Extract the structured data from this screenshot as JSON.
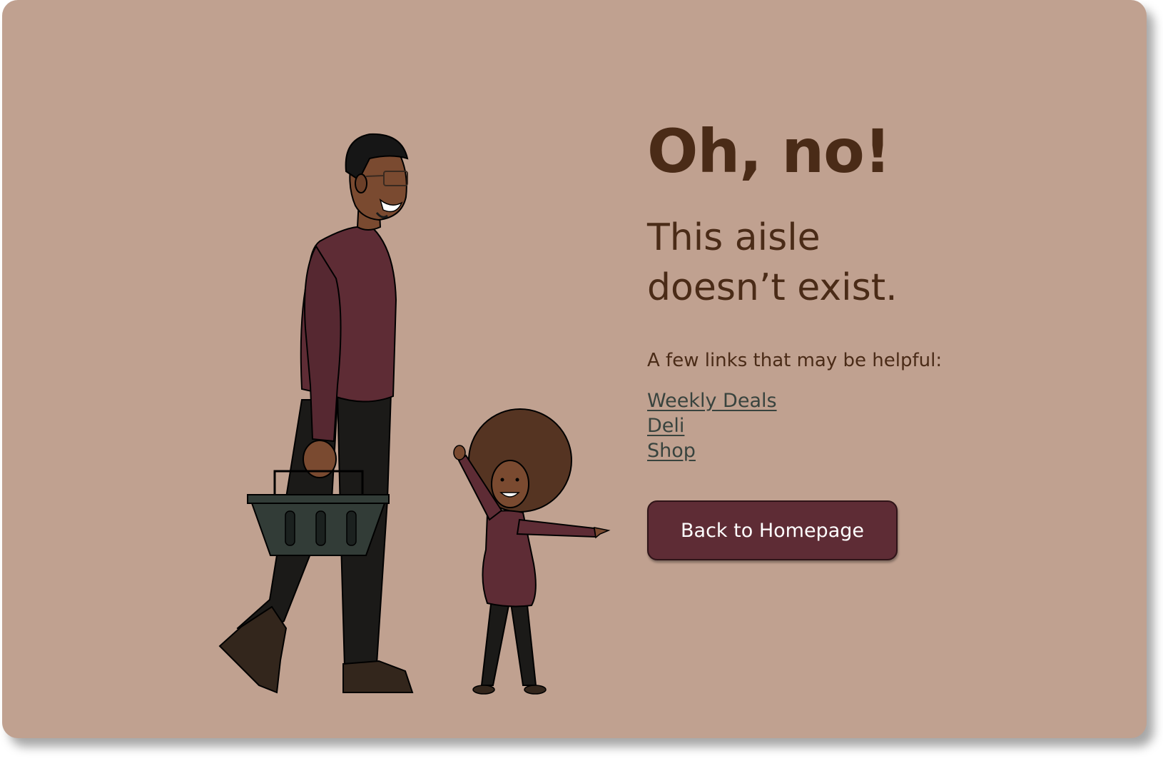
{
  "error_page": {
    "title": "Oh, no!",
    "subtitle": "This aisle doesn’t exist.",
    "helper_text": "A few links that may be helpful:",
    "links": [
      {
        "label": "Weekly Deals"
      },
      {
        "label": "Deli"
      },
      {
        "label": "Shop"
      }
    ],
    "home_button_label": "Back to Homepage"
  },
  "illustration": {
    "subject": "man-with-shopping-basket-and-pointing-child",
    "icons": [
      "shopping-basket-icon"
    ]
  },
  "colors": {
    "background": "#c0a190",
    "text": "#4a2b17",
    "link": "#38433e",
    "button": "#5e2c35",
    "shirt": "#5e2c35",
    "pants": "#1b1a18",
    "skin": "#7a4a30",
    "hair": "#553422",
    "basket": "#323c37"
  }
}
